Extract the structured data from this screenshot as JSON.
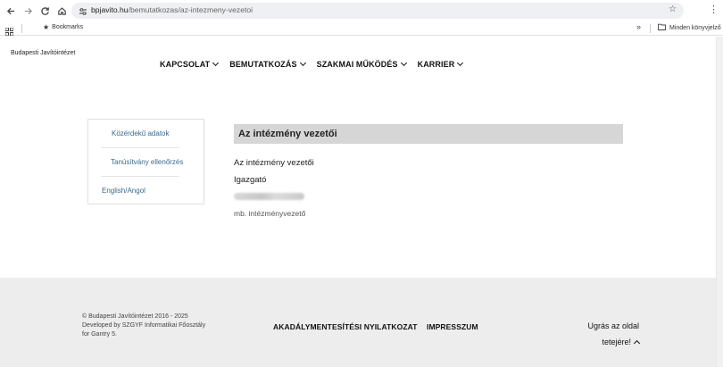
{
  "browser": {
    "url_host": "bpjavito.hu",
    "url_path": "/bemutatkozas/az-intezmeny-vezetoi",
    "bookmarks_label": "Bookmarks",
    "all_bookmarks_label": "Minden könyvjelző"
  },
  "site": {
    "logo_text": "Budapesti Javítóintézet",
    "nav": [
      "KAPCSOLAT",
      "BEMUTATKOZÁS",
      "SZAKMAI MŰKÖDÉS",
      "KARRIER"
    ]
  },
  "sidebar": {
    "items": [
      "Közérdekű adatok",
      "Tanúsítvány ellenőrzés",
      "English/Angol"
    ]
  },
  "content": {
    "title": "Az intézmény vezetői",
    "subheading": "Az intézmény vezetői",
    "role": "Igazgató",
    "deputy_role": "mb. intézményvezető"
  },
  "footer": {
    "copyright_lines": [
      "© Budapesti Javítóintézet 2016 - 2025",
      "Developed by SZGYF Informatikai Főosztály",
      "for Gantry 5."
    ],
    "accessibility": "AKADÁLYMENTESÍTÉSI NYILATKOZAT",
    "impressum": "IMPRESSZUM",
    "back_to_top_line1": "Ugrás az oldal",
    "back_to_top_line2": "tetejére!"
  }
}
